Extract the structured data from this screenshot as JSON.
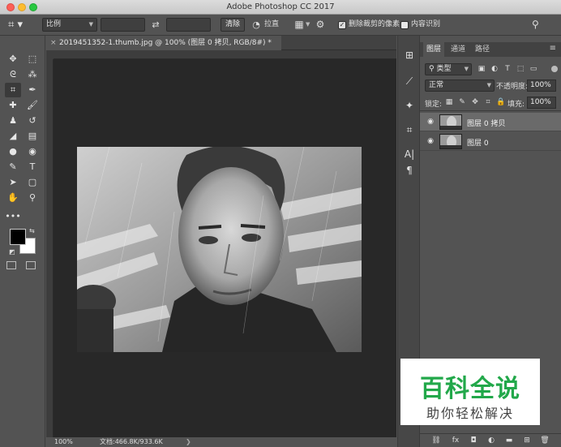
{
  "window": {
    "title": "Adobe Photoshop CC 2017"
  },
  "options_bar": {
    "ratio_select": "比例",
    "width_value": "",
    "height_value": "",
    "clear_label": "清除",
    "straighten_label": "拉直",
    "delete_cropped_label": "删除裁剪的像素",
    "delete_cropped_checked": true,
    "content_aware_label": "内容识别",
    "content_aware_checked": false
  },
  "document": {
    "tab_title": "2019451352-1.thumb.jpg @ 100% (图层 0 拷贝, RGB/8#) *",
    "zoom": "100%",
    "doc_info": "文档:466.8K/933.6K"
  },
  "layers_panel": {
    "tabs": [
      "图层",
      "通道",
      "路径"
    ],
    "active_tab": 0,
    "filter_kind": "类型",
    "blend_mode": "正常",
    "opacity_label": "不透明度:",
    "opacity_value": "100%",
    "lock_label": "锁定:",
    "fill_label": "填充:",
    "fill_value": "100%",
    "layers": [
      {
        "name": "图层 0 拷贝",
        "selected": true
      },
      {
        "name": "图层 0",
        "selected": false
      }
    ]
  },
  "watermark": {
    "title": "百科全说",
    "subtitle": "助你轻松解决"
  },
  "colors": {
    "foreground": "#000000",
    "background": "#ffffff",
    "accent": "#22a84a"
  }
}
